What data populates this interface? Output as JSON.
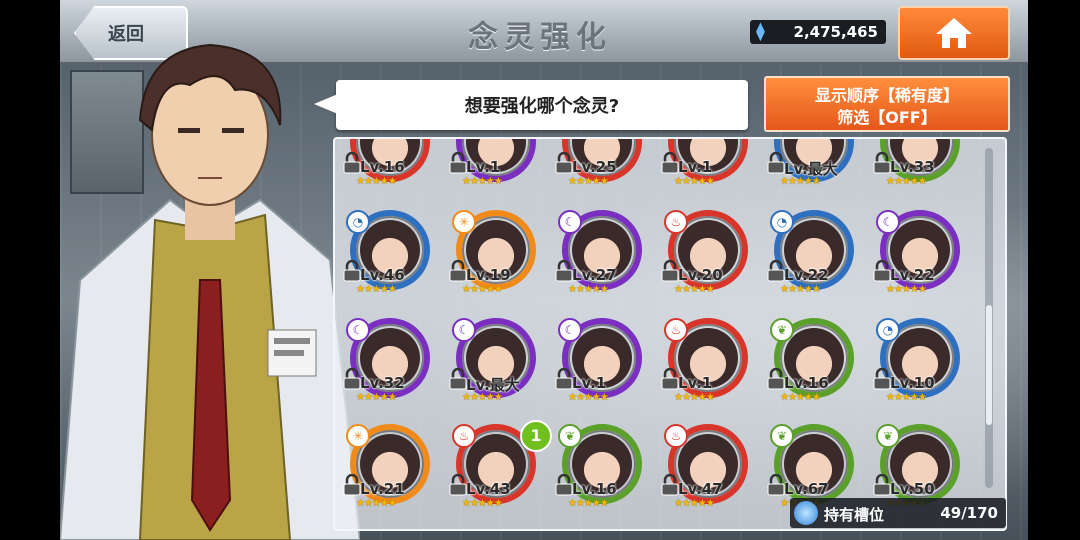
{
  "header": {
    "back_label": "返回",
    "title": "念灵强化",
    "currency_value": "2,475,465",
    "currency_icon": "gem-icon",
    "home_icon": "home-icon"
  },
  "dialog": {
    "prompt": "想要强化哪个念灵?"
  },
  "sort": {
    "order_label": "显示顺序【稀有度】",
    "filter_label": "筛选【OFF】"
  },
  "slots": {
    "label": "持有槽位",
    "count": "49/170"
  },
  "new_badge": "1",
  "colors": {
    "purple_ring": "#7a2fc0",
    "orange_ring": "#f08a19",
    "red_ring": "#d8362a",
    "green_ring": "#5aa02a",
    "blue_ring": "#2f6fc0"
  },
  "rows": [
    [
      {
        "level": "Lv.16",
        "stars": "★★★★★",
        "element": "fire"
      },
      {
        "level": "Lv.1",
        "stars": "★★★★★",
        "element": "dark"
      },
      {
        "level": "Lv.25",
        "stars": "★★★★★",
        "element": "fire"
      },
      {
        "level": "Lv.1",
        "stars": "★★★★★",
        "element": "fire"
      },
      {
        "level": "Lv.最大",
        "stars": "★★★★★",
        "element": "water"
      },
      {
        "level": "Lv.33",
        "stars": "★★★★★",
        "element": "wind"
      }
    ],
    [
      {
        "level": "Lv.46",
        "stars": "★★★★★",
        "element": "water"
      },
      {
        "level": "Lv.19",
        "stars": "★★★★★",
        "element": "light"
      },
      {
        "level": "Lv.27",
        "stars": "★★★★★",
        "element": "dark"
      },
      {
        "level": "Lv.20",
        "stars": "★★★★★",
        "element": "fire"
      },
      {
        "level": "Lv.22",
        "stars": "★★★★★",
        "element": "water"
      },
      {
        "level": "Lv.22",
        "stars": "★★★★★",
        "element": "dark"
      }
    ],
    [
      {
        "level": "Lv.32",
        "stars": "★★★★★",
        "element": "dark"
      },
      {
        "level": "Lv.最大",
        "stars": "★★★★★",
        "element": "dark"
      },
      {
        "level": "Lv.1",
        "stars": "★★★★★",
        "element": "dark"
      },
      {
        "level": "Lv.1",
        "stars": "★★★★★",
        "element": "fire"
      },
      {
        "level": "Lv.16",
        "stars": "★★★★★",
        "element": "wind"
      },
      {
        "level": "Lv.10",
        "stars": "★★★★★",
        "element": "water"
      }
    ],
    [
      {
        "level": "Lv.21",
        "stars": "★★★★★",
        "element": "light"
      },
      {
        "level": "Lv.43",
        "stars": "★★★★★",
        "element": "fire"
      },
      {
        "level": "Lv.16",
        "stars": "★★★★★",
        "element": "wind"
      },
      {
        "level": "Lv.47",
        "stars": "★★★★★",
        "element": "fire"
      },
      {
        "level": "Lv.67",
        "stars": "★★★★★",
        "element": "wind"
      },
      {
        "level": "Lv.50",
        "stars": "★★★★★",
        "element": "wind"
      }
    ]
  ]
}
